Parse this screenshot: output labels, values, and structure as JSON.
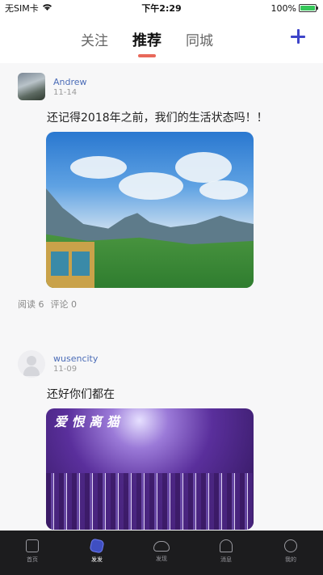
{
  "status_bar": {
    "carrier": "无SIM卡",
    "time": "下午2:29",
    "battery": "100%",
    "battery_level": 1.0
  },
  "top_nav": {
    "tabs": [
      {
        "label": "关注",
        "active": false
      },
      {
        "label": "推荐",
        "active": true
      },
      {
        "label": "同城",
        "active": false
      }
    ],
    "add_icon": "plus-icon",
    "accent_color": "#3e45c9",
    "underline_color": "#e8685a"
  },
  "feed": {
    "posts": [
      {
        "username": "Andrew",
        "date": "11-14",
        "text": "还记得2018年之前，我们的生活状态吗！！",
        "image": "mountain-landscape-photo",
        "reads_label": "阅读",
        "reads": "6",
        "comments_label": "评论",
        "comments": "0"
      },
      {
        "username": "wusencity",
        "date": "11-09",
        "text": "还好你们都在",
        "image": "concert-crowd-photo",
        "image_overlay_text": "爱 恨 离 猫"
      }
    ]
  },
  "bottom_bar": {
    "items": [
      {
        "label": "首页",
        "icon": "home-icon",
        "active": false
      },
      {
        "label": "发发",
        "icon": "post-icon",
        "active": true
      },
      {
        "label": "发现",
        "icon": "discover-icon",
        "active": false
      },
      {
        "label": "消息",
        "icon": "bell-icon",
        "active": false
      },
      {
        "label": "我的",
        "icon": "profile-icon",
        "active": false
      }
    ]
  }
}
